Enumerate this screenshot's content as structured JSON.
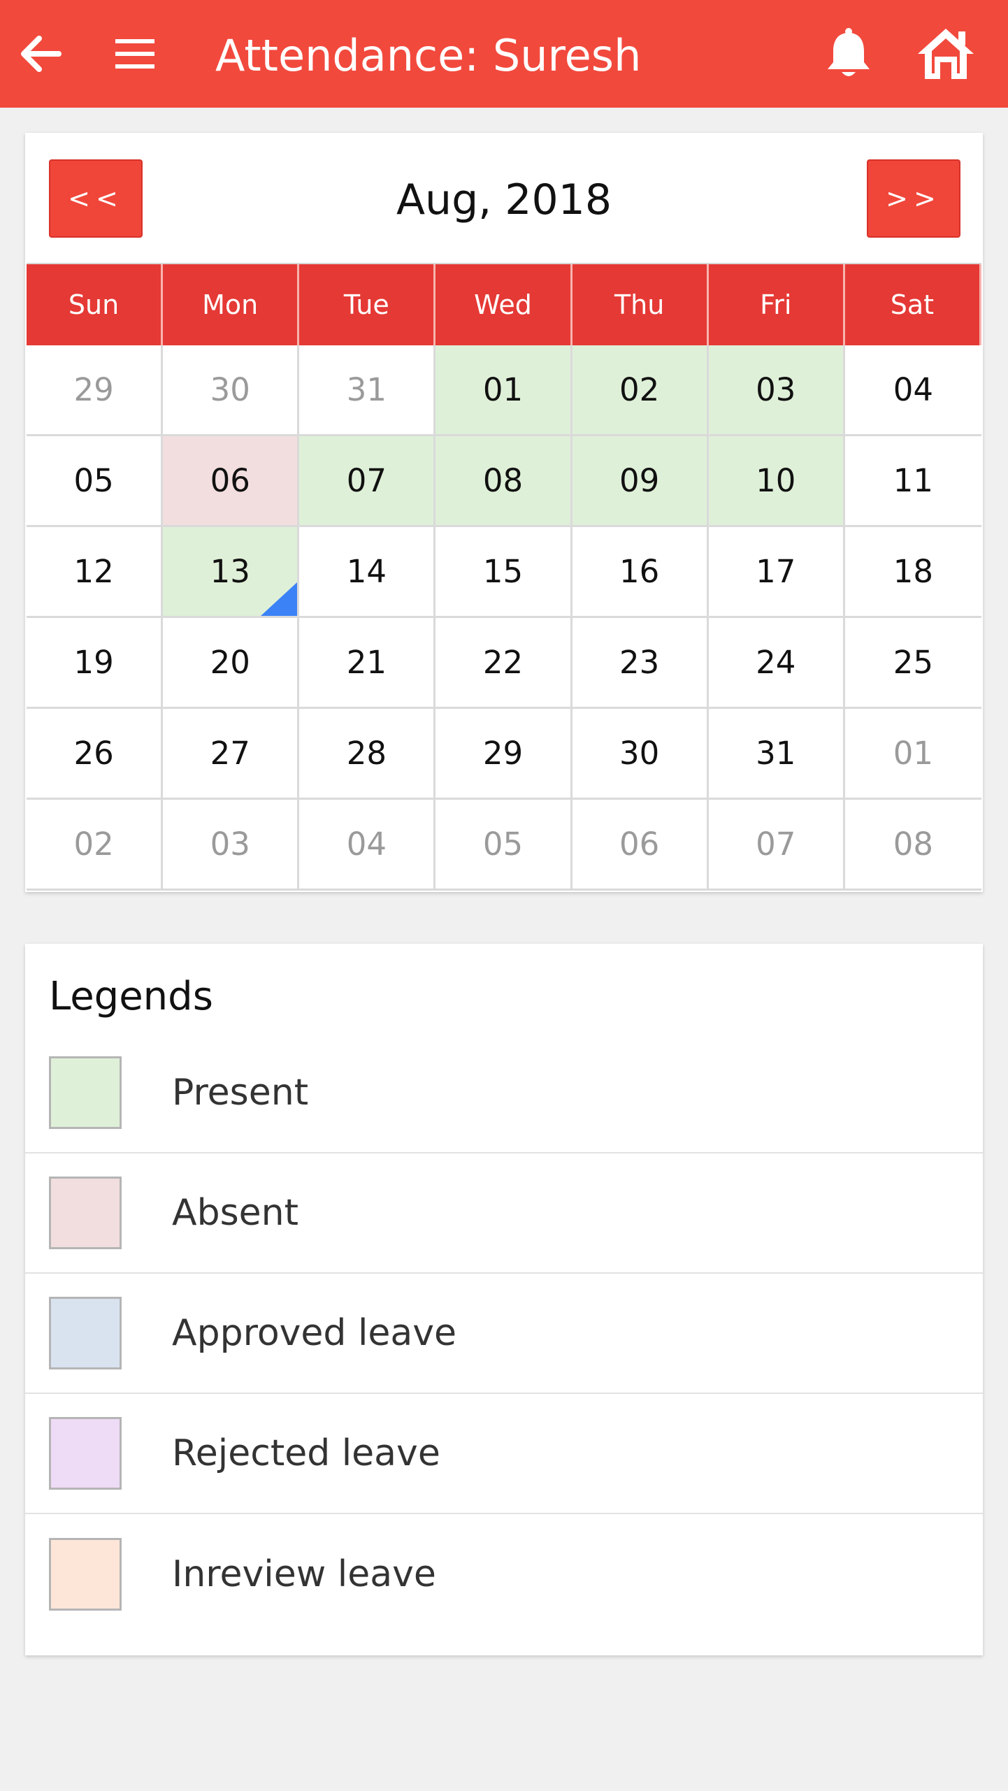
{
  "header": {
    "title": "Attendance: Suresh",
    "icons": [
      "back-arrow-icon",
      "menu-icon",
      "bell-icon",
      "home-icon"
    ]
  },
  "calendar": {
    "prev_label": "<<",
    "next_label": ">>",
    "month": "Aug, 2018",
    "weekdays": [
      "Sun",
      "Mon",
      "Tue",
      "Wed",
      "Thu",
      "Fri",
      "Sat"
    ],
    "days": [
      {
        "d": "29",
        "type": "other"
      },
      {
        "d": "30",
        "type": "other"
      },
      {
        "d": "31",
        "type": "other"
      },
      {
        "d": "01",
        "type": "present"
      },
      {
        "d": "02",
        "type": "present"
      },
      {
        "d": "03",
        "type": "present"
      },
      {
        "d": "04",
        "type": "normal"
      },
      {
        "d": "05",
        "type": "normal"
      },
      {
        "d": "06",
        "type": "absent"
      },
      {
        "d": "07",
        "type": "present"
      },
      {
        "d": "08",
        "type": "present"
      },
      {
        "d": "09",
        "type": "present"
      },
      {
        "d": "10",
        "type": "present"
      },
      {
        "d": "11",
        "type": "normal"
      },
      {
        "d": "12",
        "type": "normal"
      },
      {
        "d": "13",
        "type": "present",
        "flag": true
      },
      {
        "d": "14",
        "type": "normal"
      },
      {
        "d": "15",
        "type": "normal"
      },
      {
        "d": "16",
        "type": "normal"
      },
      {
        "d": "17",
        "type": "normal"
      },
      {
        "d": "18",
        "type": "normal"
      },
      {
        "d": "19",
        "type": "normal"
      },
      {
        "d": "20",
        "type": "normal"
      },
      {
        "d": "21",
        "type": "normal"
      },
      {
        "d": "22",
        "type": "normal"
      },
      {
        "d": "23",
        "type": "normal"
      },
      {
        "d": "24",
        "type": "normal"
      },
      {
        "d": "25",
        "type": "normal"
      },
      {
        "d": "26",
        "type": "normal"
      },
      {
        "d": "27",
        "type": "normal"
      },
      {
        "d": "28",
        "type": "normal"
      },
      {
        "d": "29",
        "type": "normal"
      },
      {
        "d": "30",
        "type": "normal"
      },
      {
        "d": "31",
        "type": "normal"
      },
      {
        "d": "01",
        "type": "other"
      },
      {
        "d": "02",
        "type": "other"
      },
      {
        "d": "03",
        "type": "other"
      },
      {
        "d": "04",
        "type": "other"
      },
      {
        "d": "05",
        "type": "other"
      },
      {
        "d": "06",
        "type": "other"
      },
      {
        "d": "07",
        "type": "other"
      },
      {
        "d": "08",
        "type": "other"
      }
    ]
  },
  "legend": {
    "title": "Legends",
    "items": [
      {
        "label": "Present",
        "color": "#dff0d8"
      },
      {
        "label": "Absent",
        "color": "#f2dede"
      },
      {
        "label": "Approved leave",
        "color": "#d9e3f0"
      },
      {
        "label": "Rejected leave",
        "color": "#eedbf6"
      },
      {
        "label": "Inreview leave",
        "color": "#fde6d8"
      }
    ]
  },
  "colors": {
    "appbar": "#f2493d",
    "weekday_header": "#e53935",
    "flag": "#3b82f6"
  }
}
